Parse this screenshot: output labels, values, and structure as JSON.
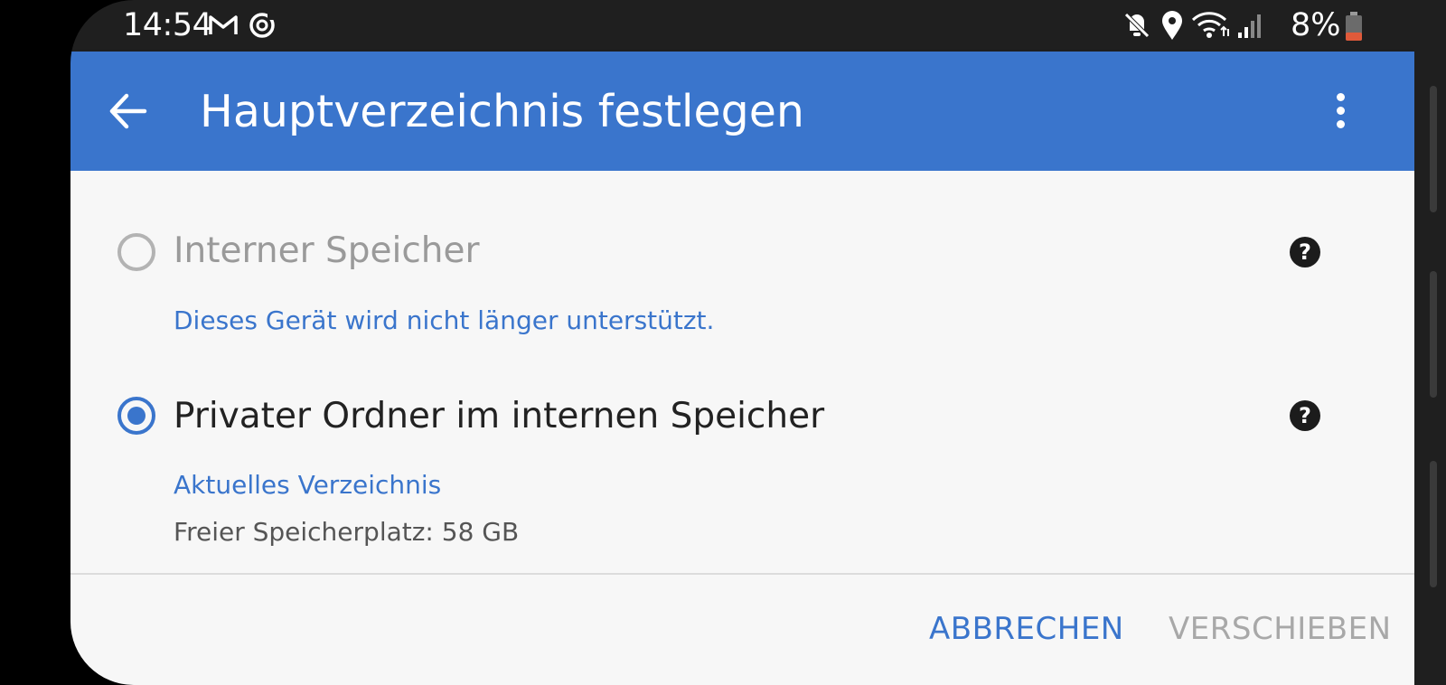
{
  "status_bar": {
    "time": "14:54",
    "battery": "8%",
    "icons": [
      "gmail-icon",
      "sync-icon",
      "mute-icon",
      "location-icon",
      "wifi-icon",
      "signal-icon",
      "battery-low-icon"
    ]
  },
  "app_bar": {
    "title": "Hauptverzeichnis festlegen",
    "back_icon": "arrow-back-icon",
    "menu_icon": "more-vert-icon",
    "color": "#3a75cc"
  },
  "options": [
    {
      "label": "Interner Speicher",
      "selected": false,
      "disabled": true,
      "note": "Dieses Gerät wird nicht länger unterstützt."
    },
    {
      "label": "Privater Ordner im internen Speicher",
      "selected": true,
      "disabled": false,
      "note": "Aktuelles Verzeichnis",
      "free_space": "Freier Speicherplatz: 58 GB"
    }
  ],
  "help_symbol": "?",
  "buttons": {
    "cancel": "ABBRECHEN",
    "move": "VERSCHIEBEN"
  },
  "colors": {
    "accent": "#3a75cc",
    "disabled_text": "#9a9a9a",
    "battery_low": "#e05a3a"
  }
}
